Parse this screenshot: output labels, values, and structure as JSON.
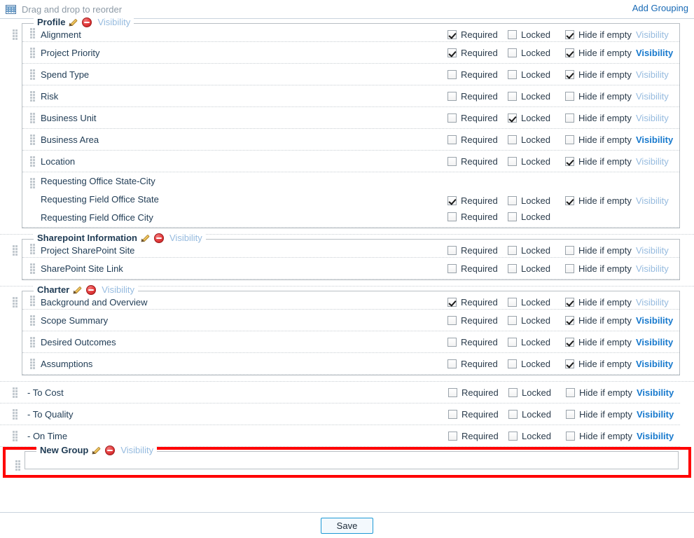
{
  "topbar": {
    "icon": "grid-icon",
    "label": "Drag and drop to reorder",
    "add_grouping_label": "Add Grouping"
  },
  "labels": {
    "required": "Required",
    "locked": "Locked",
    "hide_if_empty": "Hide if empty",
    "visibility": "Visibility",
    "edit_icon": "pencil-icon",
    "delete_icon": "delete-circle-icon",
    "drag_icon": "drag-handle-icon"
  },
  "footer": {
    "save_label": "Save"
  },
  "colors": {
    "link_active": "#1779cd",
    "link_inactive": "#96bbdf",
    "highlight_border": "#ff0000",
    "save_border": "#1e9ad6"
  },
  "groups": [
    {
      "title": "Profile",
      "visibility_active": false,
      "rows": [
        {
          "label": "Alignment",
          "required": true,
          "locked": false,
          "hide_if_empty": true,
          "visibility_active": false
        },
        {
          "label": "Project Priority",
          "required": true,
          "locked": false,
          "hide_if_empty": true,
          "visibility_active": true
        },
        {
          "label": "Spend Type",
          "required": false,
          "locked": false,
          "hide_if_empty": true,
          "visibility_active": false
        },
        {
          "label": "Risk",
          "required": false,
          "locked": false,
          "hide_if_empty": false,
          "visibility_active": false
        },
        {
          "label": "Business Unit",
          "required": false,
          "locked": true,
          "hide_if_empty": false,
          "visibility_active": false
        },
        {
          "label": "Business Area",
          "required": false,
          "locked": false,
          "hide_if_empty": false,
          "visibility_active": true
        },
        {
          "label": "Location",
          "required": false,
          "locked": false,
          "hide_if_empty": true,
          "visibility_active": false
        }
      ],
      "composite_row": {
        "labels": [
          "Requesting Office State-City",
          "Requesting Field Office State",
          "Requesting Field Office City"
        ],
        "required": true,
        "locked": false,
        "hide_if_empty": true,
        "visibility_active": false,
        "sub_required": false,
        "sub_locked": false
      }
    },
    {
      "title": "Sharepoint Information",
      "visibility_active": false,
      "rows": [
        {
          "label": "Project SharePoint Site",
          "required": false,
          "locked": false,
          "hide_if_empty": false,
          "visibility_active": false
        },
        {
          "label": "SharePoint Site Link",
          "required": false,
          "locked": false,
          "hide_if_empty": false,
          "visibility_active": false
        }
      ]
    },
    {
      "title": "Charter",
      "visibility_active": false,
      "rows": [
        {
          "label": "Background and Overview",
          "required": true,
          "locked": false,
          "hide_if_empty": true,
          "visibility_active": false
        },
        {
          "label": "Scope Summary",
          "required": false,
          "locked": false,
          "hide_if_empty": true,
          "visibility_active": true
        },
        {
          "label": "Desired Outcomes",
          "required": false,
          "locked": false,
          "hide_if_empty": true,
          "visibility_active": true
        },
        {
          "label": "Assumptions",
          "required": false,
          "locked": false,
          "hide_if_empty": true,
          "visibility_active": true
        }
      ]
    }
  ],
  "loose_rows": [
    {
      "label": "- To Cost",
      "required": false,
      "locked": false,
      "hide_if_empty": false,
      "visibility_active": true
    },
    {
      "label": "- To Quality",
      "required": false,
      "locked": false,
      "hide_if_empty": false,
      "visibility_active": true
    },
    {
      "label": "- On Time",
      "required": false,
      "locked": false,
      "hide_if_empty": false,
      "visibility_active": true
    }
  ],
  "new_group": {
    "title": "New Group",
    "visibility_active": false,
    "highlighted": true
  }
}
